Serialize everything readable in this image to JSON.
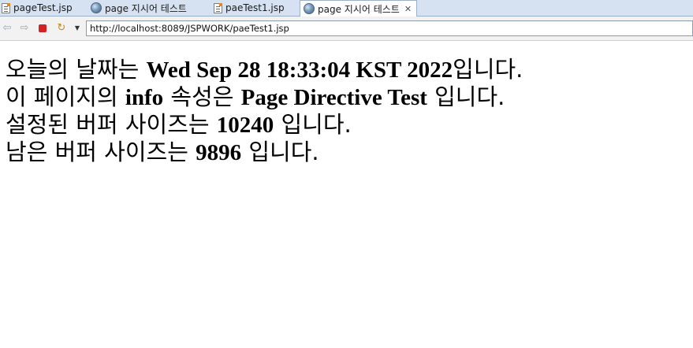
{
  "tabs": [
    {
      "label": "pageTest.jsp",
      "icon": "jsp-file-icon"
    },
    {
      "label": "page 지시어 테스트",
      "icon": "globe-icon"
    },
    {
      "label": "paeTest1.jsp",
      "icon": "jsp-file-icon"
    },
    {
      "label": "page 지시어 테스트",
      "icon": "globe-icon",
      "active": true,
      "close": "✕"
    }
  ],
  "toolbar": {
    "url": "http://localhost:8089/JSPWORK/paeTest1.jsp"
  },
  "page": {
    "line1": {
      "pre": "오늘의 날짜는 ",
      "value": "Wed Sep 28 18:33:04 KST 2022",
      "post": "입니다."
    },
    "line2": {
      "pre": "이 페이지의 ",
      "info": "info",
      "mid": " 속성은 ",
      "value": "Page Directive Test",
      "post": " 입니다."
    },
    "line3": {
      "pre": "설정된 버퍼 사이즈는 ",
      "value": "10240",
      "post": " 입니다."
    },
    "line4": {
      "pre": "남은 버퍼 사이즈는 ",
      "value": "9896",
      "post": " 입니다."
    }
  },
  "colors": {
    "tabbar": "#d6e2f1",
    "stop": "#d42121",
    "refresh": "#c8891d"
  }
}
